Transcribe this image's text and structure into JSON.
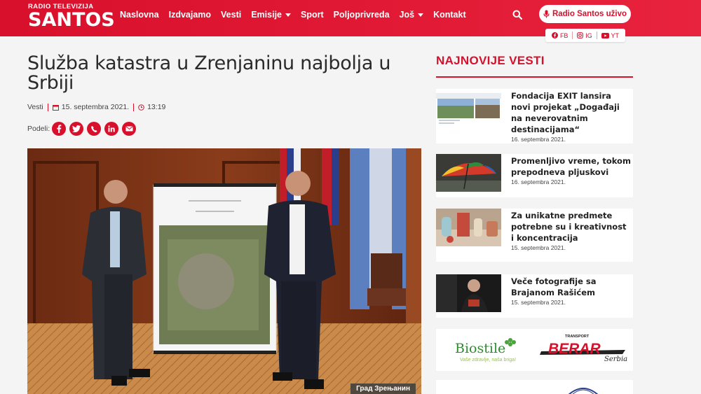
{
  "header": {
    "logo_small": "RADIO TELEVIZIJA",
    "logo_big": "SANTOS",
    "nav": [
      {
        "label": "Naslovna",
        "dropdown": false
      },
      {
        "label": "Izdvajamo",
        "dropdown": false
      },
      {
        "label": "Vesti",
        "dropdown": false
      },
      {
        "label": "Emisije",
        "dropdown": true
      },
      {
        "label": "Sport",
        "dropdown": false
      },
      {
        "label": "Poljoprivreda",
        "dropdown": false
      },
      {
        "label": "Još",
        "dropdown": true
      },
      {
        "label": "Kontakt",
        "dropdown": false
      }
    ],
    "live_button": "Radio Santos uživo",
    "social": [
      {
        "label": "FB",
        "icon": "facebook-icon"
      },
      {
        "label": "IG",
        "icon": "instagram-icon"
      },
      {
        "label": "YT",
        "icon": "youtube-icon"
      }
    ],
    "accent": "#d8102c"
  },
  "article": {
    "title": "Služba katastra u Zrenjaninu najbolja u Srbiji",
    "category": "Vesti",
    "date": "15. septembra 2021.",
    "time": "13:19",
    "share_label": "Podeli:",
    "share_buttons": [
      "facebook-icon",
      "twitter-icon",
      "viber-icon",
      "linkedin-icon",
      "email-icon"
    ],
    "photo_caption": "Град Зрењанин"
  },
  "sidebar": {
    "title": "NAJNOVIJE VESTI",
    "news": [
      {
        "title": "Fondacija EXIT lansira novi projekat „Događaji na neverovatnim destinacijama“",
        "date": "16. septembra 2021."
      },
      {
        "title": "Promenljivo vreme, tokom prepodneva pljuskovi",
        "date": "16. septembra 2021."
      },
      {
        "title": "Za unikatne predmete potrebne su i kreativnost i koncentracija",
        "date": "15. septembra 2021."
      },
      {
        "title": "Veče fotografije sa Brajanom Rašićem",
        "date": "15. septembra 2021."
      }
    ],
    "ads": {
      "biostile_name": "Biostile",
      "biostile_slogan": "Vaše zdravlje, naša briga!",
      "berar_top": "TRANSPORT",
      "berar_name": "BERAR",
      "berar_sub": "Serbia"
    }
  }
}
